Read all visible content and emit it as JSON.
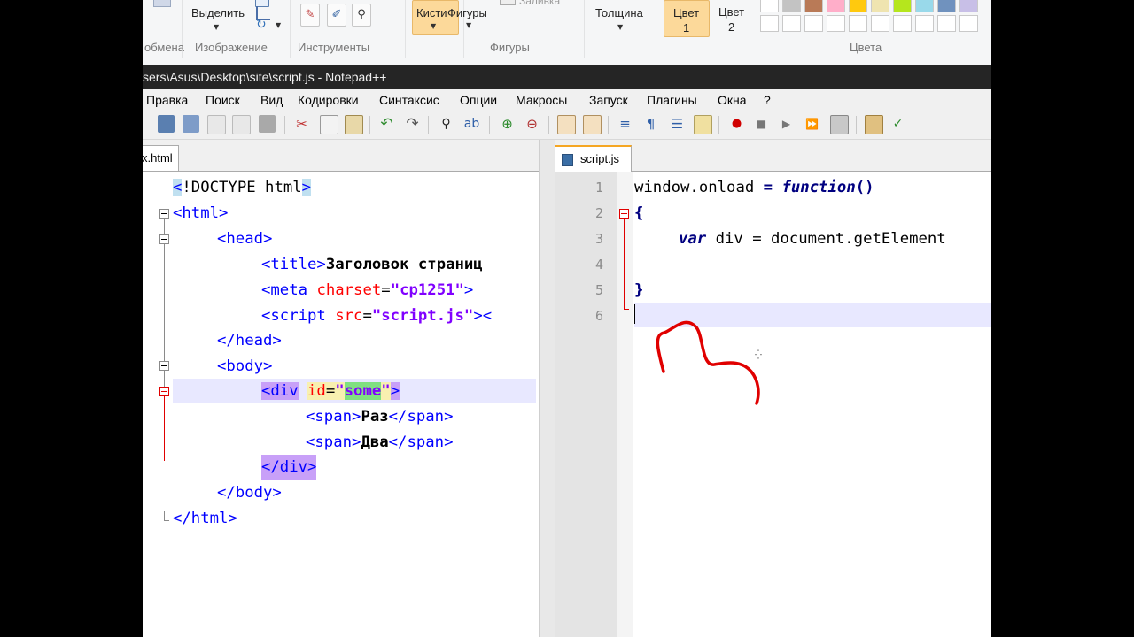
{
  "ribbon": {
    "select_label": "Выделить",
    "brushes_label": "Кисти",
    "shapes_label": "Фигуры",
    "fill_label": "Заливка",
    "thickness_label": "Толщина",
    "color1_line1": "Цвет",
    "color1_line2": "1",
    "color2_line1": "Цвет",
    "color2_line2": "2",
    "groups": {
      "clipboard": "обмена",
      "image": "Изображение",
      "tools": "Инструменты",
      "shapes": "Фигуры",
      "colors": "Цвета"
    },
    "palette_colors": [
      "#ffffff",
      "#c3c3c3",
      "#b97a57",
      "#ffaec9",
      "#ffc90e",
      "#efe4b0",
      "#b5e61d",
      "#99d9ea",
      "#7092be",
      "#c8bfe7"
    ]
  },
  "window": {
    "title": "sers\\Asus\\Desktop\\site\\script.js - Notepad++"
  },
  "menu": [
    "Правка",
    "Поиск",
    "Вид",
    "Кодировки",
    "Синтаксис",
    "Опции",
    "Макросы",
    "Запуск",
    "Плагины",
    "Окна",
    "?"
  ],
  "left_tab": {
    "label": "x.html"
  },
  "right_tab": {
    "label": "script.js"
  },
  "html_code": {
    "l1": {
      "lt": "<",
      "rest": "!DOCTYPE html",
      "gt": ">"
    },
    "l2": "<html>",
    "l3": "<head>",
    "l4": {
      "tag": "<title>",
      "text": "Заголовок страниц"
    },
    "l5": {
      "tag": "<meta ",
      "attr": "charset",
      "eq": "=",
      "val": "\"cp1251\"",
      "close": ">"
    },
    "l6": {
      "tag": "<script ",
      "attr": "src",
      "eq": "=",
      "val": "\"script.js\"",
      "close": "><"
    },
    "l7": "</head>",
    "l8": "<body>",
    "l9": {
      "open": "<div",
      "space": " ",
      "attr": "id",
      "eq": "=",
      "q1": "\"",
      "val": "some",
      "q2": "\"",
      "close": ">"
    },
    "l10": {
      "open": "<span>",
      "text": "Раз",
      "close": "</span>"
    },
    "l11": {
      "open": "<span>",
      "text": "Два",
      "close": "</span>"
    },
    "l12": "</div>",
    "l13": "</body>",
    "l14": "</html>"
  },
  "js_code": {
    "line_numbers": [
      "1",
      "2",
      "3",
      "4",
      "5",
      "6"
    ],
    "l1": {
      "a": "window.onload ",
      "eq": "=",
      "sp": " ",
      "kw": "function",
      "paren": "()"
    },
    "l2": "{",
    "l3": {
      "kw": "var",
      "rest": " div = document.getElement"
    },
    "l5": "}"
  }
}
